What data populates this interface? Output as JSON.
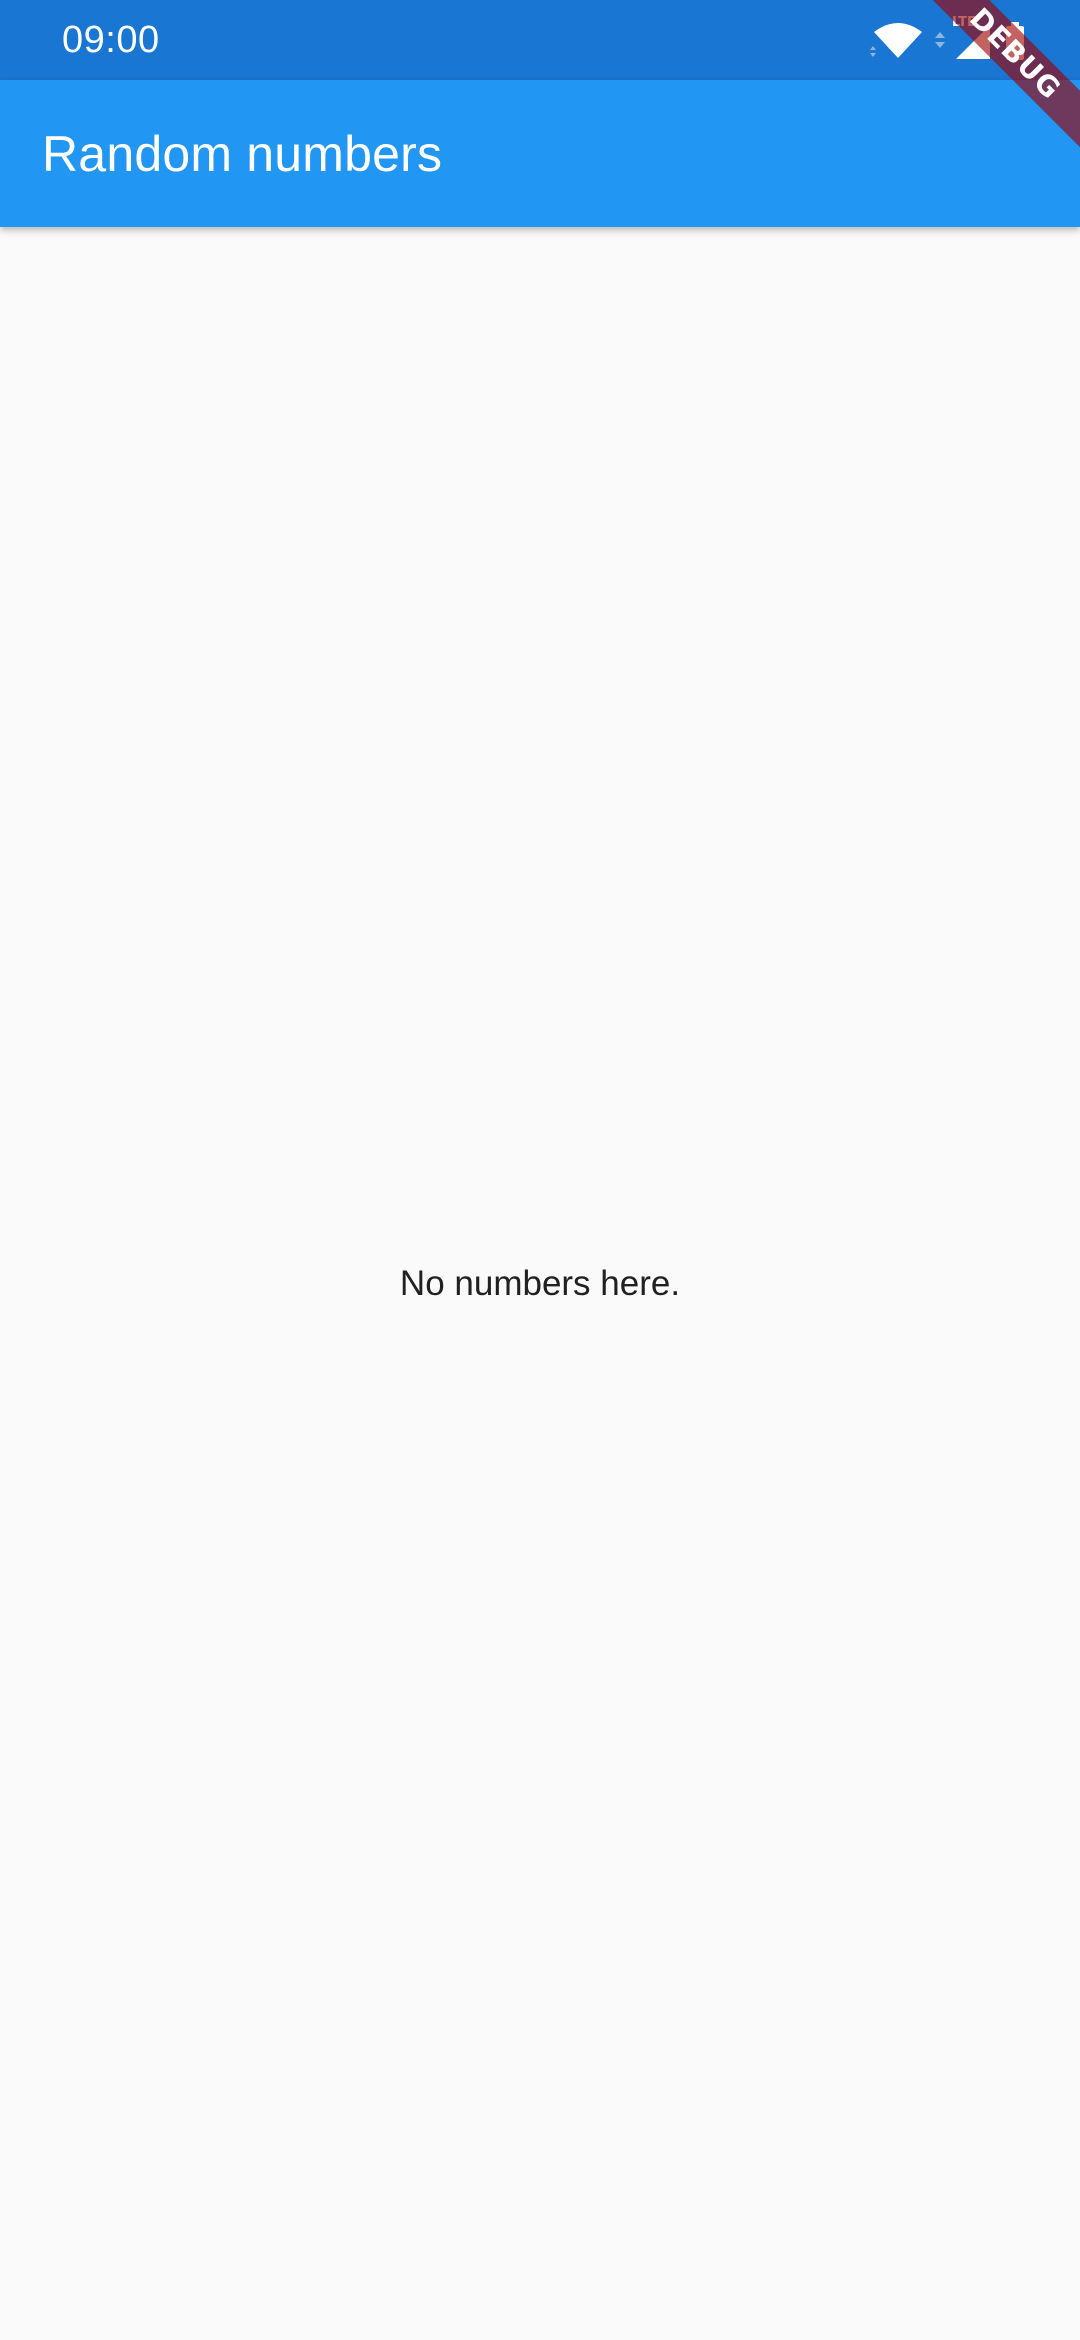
{
  "status_bar": {
    "time": "09:00",
    "icons": [
      "wifi-icon",
      "data-activity-icon",
      "cell-signal-icon",
      "battery-icon"
    ],
    "network_type": "LTE"
  },
  "app_bar": {
    "title": "Random numbers"
  },
  "main": {
    "empty_message": "No numbers here."
  },
  "debug_banner": {
    "label": "DEBUG"
  },
  "colors": {
    "status_bar": "#1976d2",
    "app_bar": "#2196f3",
    "background": "#fafafa",
    "text": "#212121",
    "debug_banner": "#a00000"
  }
}
